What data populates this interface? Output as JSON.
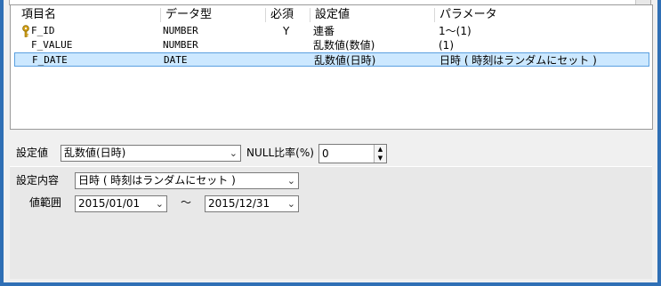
{
  "grid": {
    "headers": [
      "項目名",
      "データ型",
      "必須",
      "設定値",
      "パラメータ"
    ],
    "rows": [
      {
        "name": "F_ID",
        "type": "NUMBER",
        "required": "Y",
        "setting": "連番",
        "param": "1～(1)",
        "is_key": true,
        "selected": false
      },
      {
        "name": "F_VALUE",
        "type": "NUMBER",
        "required": "",
        "setting": "乱数値(数値)",
        "param": "(1)",
        "is_key": false,
        "selected": false
      },
      {
        "name": "F_DATE",
        "type": "DATE",
        "required": "",
        "setting": "乱数値(日時)",
        "param": "日時 ( 時刻はランダムにセット )",
        "is_key": false,
        "selected": true
      }
    ]
  },
  "setting": {
    "label": "設定値",
    "value": "乱数値(日時)",
    "null_label": "NULL比率(%)",
    "null_value": "0"
  },
  "detail": {
    "label": "設定内容",
    "value": "日時 ( 時刻はランダムにセット )",
    "range_label": "値範囲",
    "range_from": "2015/01/01",
    "range_sep": "～",
    "range_to": "2015/12/31"
  },
  "colors": {
    "window_border": "#2f6fb5",
    "selection": "#cce8ff",
    "key_icon": "#d4a017"
  },
  "icons": {
    "key": "key-icon",
    "dropdown": "chevron-down-icon",
    "spin_up": "spin-up-icon",
    "spin_down": "spin-down-icon"
  }
}
